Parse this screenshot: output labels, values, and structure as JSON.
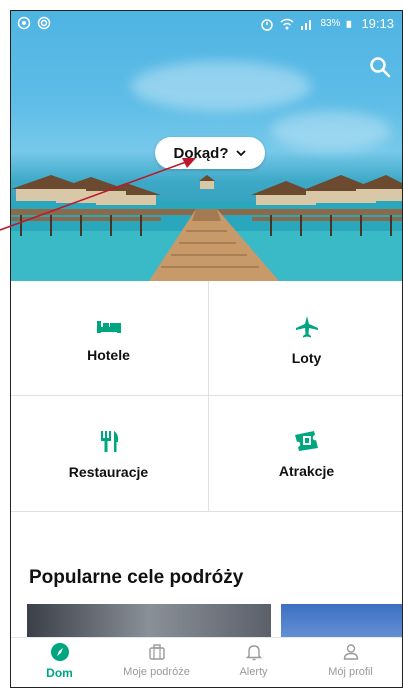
{
  "status_bar": {
    "battery": "83%",
    "time": "19:13"
  },
  "hero": {
    "where_label": "Dokąd?"
  },
  "categories": [
    {
      "label": "Hotele",
      "icon": "bed-icon"
    },
    {
      "label": "Loty",
      "icon": "plane-icon"
    },
    {
      "label": "Restauracje",
      "icon": "fork-knife-icon"
    },
    {
      "label": "Atrakcje",
      "icon": "ticket-icon"
    }
  ],
  "popular": {
    "title": "Popularne cele podróży"
  },
  "nav": [
    {
      "label": "Dom",
      "icon": "compass-icon",
      "active": true
    },
    {
      "label": "Moje podróże",
      "icon": "suitcase-icon"
    },
    {
      "label": "Alerty",
      "icon": "bell-icon"
    },
    {
      "label": "Mój profil",
      "icon": "person-icon"
    }
  ],
  "colors": {
    "accent": "#00a680",
    "annotation_arrow": "#c0182a"
  }
}
